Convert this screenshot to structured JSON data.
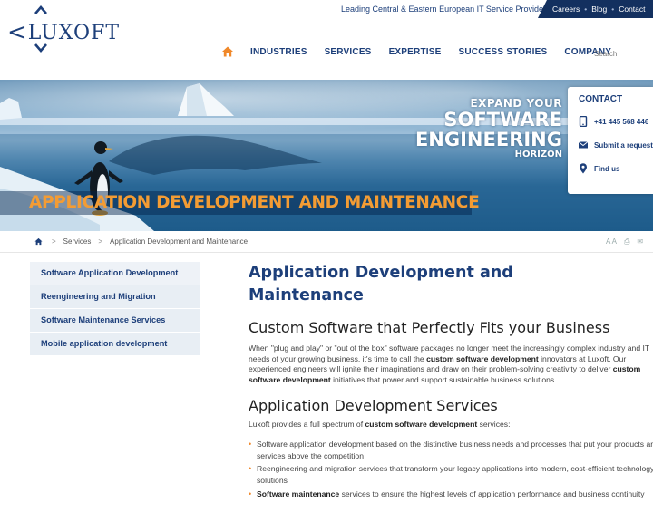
{
  "logo": {
    "text_left": "LU",
    "text_x": "X",
    "text_right": "OFT"
  },
  "header": {
    "tagline": "Leading Central & Eastern European IT Service Provider",
    "top_links": [
      "Careers",
      "Blog",
      "Contact"
    ],
    "top_link_separator": "•",
    "nav": [
      "INDUSTRIES",
      "SERVICES",
      "EXPERTISE",
      "SUCCESS STORIES",
      "COMPANY"
    ],
    "search_placeholder": "Search"
  },
  "banner": {
    "slogan": [
      "EXPAND YOUR",
      "SOFTWARE",
      "ENGINEERING",
      "HORIZON"
    ],
    "title": "APPLICATION DEVELOPMENT AND MAINTENANCE"
  },
  "contact": {
    "title": "CONTACT",
    "phone": "+41 445 568 446",
    "submit": "Submit a request",
    "find": "Find us"
  },
  "breadcrumb": {
    "items": [
      "Services",
      "Application Development and Maintenance"
    ],
    "separator": ">",
    "tools": [
      "A A",
      "⎙",
      "✉"
    ]
  },
  "sidebar": {
    "items": [
      "Software Application Development",
      "Reengineering and Migration",
      "Software Maintenance Services",
      "Mobile application development"
    ]
  },
  "content": {
    "heading": "Application Development and Maintenance",
    "sub1": "Custom Software that Perfectly Fits your Business",
    "p1_a": "When \"plug and play\" or \"out of the box\" software packages no longer meet the increasingly complex industry and IT needs of your growing business, it's time to call the ",
    "p1_b": "custom software development",
    "p1_c": " innovators at Luxoft. Our experienced engineers will ignite their imaginations and draw on their problem-solving creativity to deliver ",
    "p1_d": "custom software development",
    "p1_e": " initiatives that power and support sustainable business solutions.",
    "sub2": "Application Development Services",
    "p2_a": "Luxoft provides a full spectrum of ",
    "p2_b": "custom software development",
    "p2_c": " services:",
    "bullets": [
      {
        "bold": "",
        "text": "Software application development based on the distinctive business needs and processes that put your products and services above the competition"
      },
      {
        "bold": "",
        "text": "Reengineering and migration services that transform your legacy applications into modern, cost-efficient technology solutions"
      },
      {
        "bold": "Software maintenance",
        "text": " services to ensure the highest levels of application performance and business continuity"
      }
    ],
    "bullet_glyph": "•"
  },
  "colors": {
    "brand_blue": "#1d3f7a",
    "accent_orange": "#f39c34",
    "nav_dark": "#13305f"
  }
}
